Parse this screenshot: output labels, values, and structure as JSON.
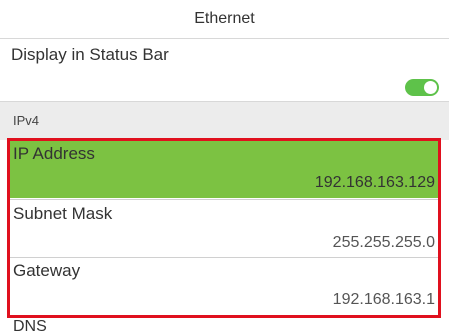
{
  "header": {
    "title": "Ethernet"
  },
  "status_bar": {
    "label": "Display in Status Bar",
    "toggle_on": true
  },
  "section": {
    "label": "IPv4"
  },
  "fields": [
    {
      "name": "IP Address",
      "value": "192.168.163.129",
      "active": true
    },
    {
      "name": "Subnet Mask",
      "value": "255.255.255.0",
      "active": false
    },
    {
      "name": "Gateway",
      "value": "192.168.163.1",
      "active": false
    }
  ],
  "dns": {
    "label": "DNS"
  },
  "colors": {
    "active_row": "#7cc242",
    "toggle": "#5ec24a",
    "highlight_border": "#e0101e",
    "section_bg": "#ececec"
  }
}
